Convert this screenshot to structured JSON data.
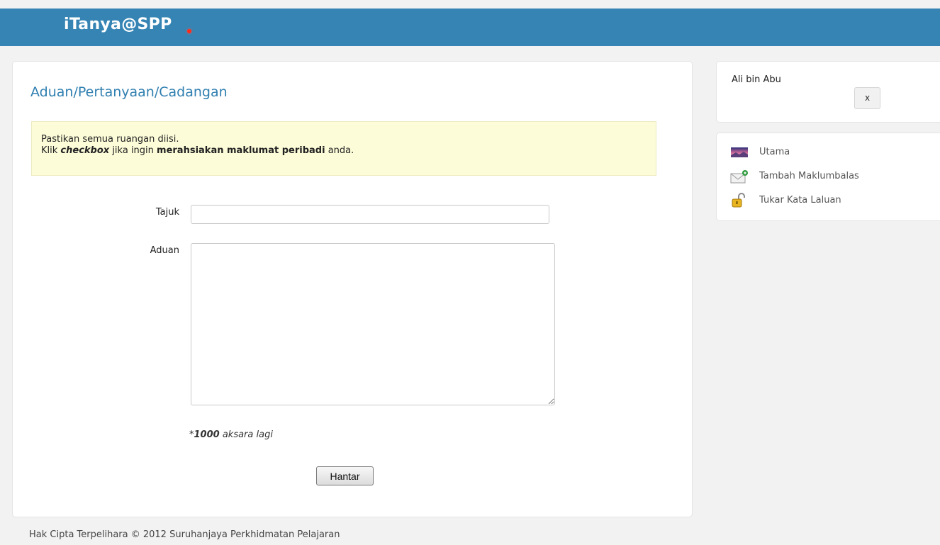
{
  "header": {
    "app_title": "iTanya@SPP"
  },
  "main": {
    "title": "Aduan/Pertanyaan/Cadangan",
    "notice": {
      "line1": "Pastikan semua ruangan diisi.",
      "line2_prefix": "Klik ",
      "line2_em": "checkbox",
      "line2_mid": " jika ingin ",
      "line2_strong": "merahsiakan maklumat peribadi",
      "line2_suffix": " anda."
    },
    "form": {
      "tajuk_label": "Tajuk",
      "tajuk_value": "",
      "aduan_label": "Aduan",
      "aduan_value": "",
      "counter_prefix": "*",
      "counter_number": "1000",
      "counter_suffix": " aksara lagi",
      "submit_label": "Hantar"
    }
  },
  "user": {
    "name": "Ali bin Abu",
    "close_label": "x"
  },
  "menu": {
    "items": [
      {
        "label": "Utama",
        "icon": "home-landscape-icon"
      },
      {
        "label": "Tambah Maklumbalas",
        "icon": "mail-add-icon"
      },
      {
        "label": "Tukar Kata Laluan",
        "icon": "padlock-open-icon"
      }
    ]
  },
  "footer": {
    "text": "Hak Cipta Terpelihara © 2012 Suruhanjaya Perkhidmatan Pelajaran"
  },
  "colors": {
    "header": "#3584b4",
    "title": "#2f7fb0",
    "notice_bg": "#fcfcd9",
    "logo_dot": "#ff2a1a"
  }
}
